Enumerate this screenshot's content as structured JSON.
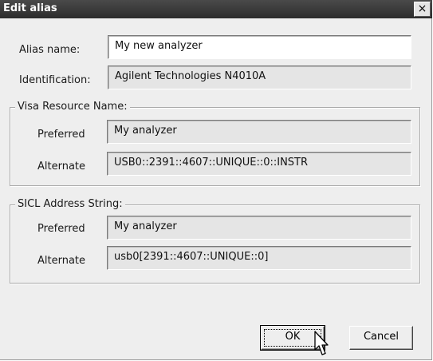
{
  "window": {
    "title": "Edit alias",
    "close_glyph": "×"
  },
  "alias": {
    "label": "Alias name:",
    "value": "My new analyzer"
  },
  "identification": {
    "label": "Identification:",
    "value": "Agilent Technologies N4010A"
  },
  "visa": {
    "legend": "Visa Resource Name:",
    "preferred_label": "Preferred",
    "preferred_value": "My analyzer",
    "alternate_label": "Alternate",
    "alternate_value": "USB0::2391::4607::UNIQUE::0::INSTR"
  },
  "sicl": {
    "legend": "SICL Address String:",
    "preferred_label": "Preferred",
    "preferred_value": "My analyzer",
    "alternate_label": "Alternate",
    "alternate_value": "usb0[2391::4607::UNIQUE::0]"
  },
  "buttons": {
    "ok": "OK",
    "cancel": "Cancel"
  },
  "icons": {
    "close": "close-icon",
    "cursor": "mouse-pointer-icon"
  }
}
